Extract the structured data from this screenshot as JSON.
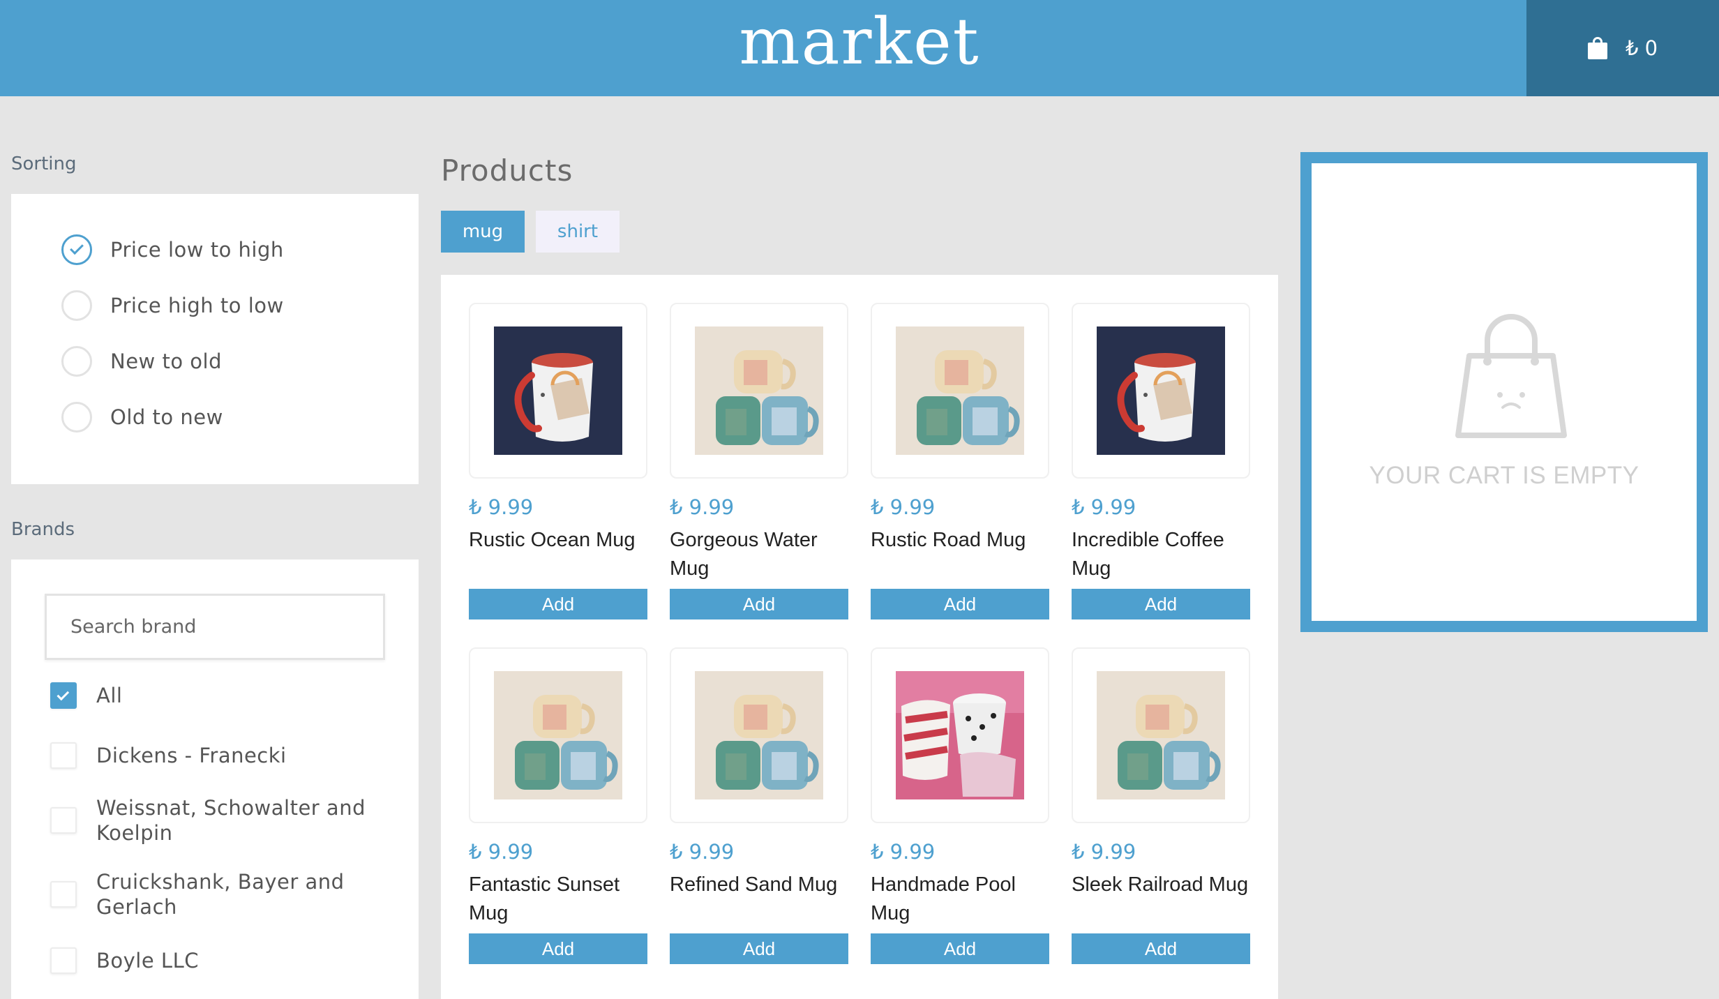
{
  "header": {
    "logo": "market",
    "cart_total": "₺ 0"
  },
  "sorting": {
    "label": "Sorting",
    "options": [
      {
        "label": "Price low to high",
        "selected": true
      },
      {
        "label": "Price high to low",
        "selected": false
      },
      {
        "label": "New to old",
        "selected": false
      },
      {
        "label": "Old to new",
        "selected": false
      }
    ]
  },
  "brands": {
    "label": "Brands",
    "search_placeholder": "Search brand",
    "items": [
      {
        "label": "All",
        "checked": true
      },
      {
        "label": "Dickens - Franecki",
        "checked": false
      },
      {
        "label": "Weissnat, Schowalter and Koelpin",
        "checked": false
      },
      {
        "label": "Cruickshank, Bayer and Gerlach",
        "checked": false
      },
      {
        "label": "Boyle LLC",
        "checked": false
      }
    ]
  },
  "products": {
    "title": "Products",
    "tags": [
      {
        "label": "mug",
        "active": true
      },
      {
        "label": "shirt",
        "active": false
      }
    ],
    "add_label": "Add",
    "items": [
      {
        "price": "₺ 9.99",
        "name": "Rustic Ocean Mug",
        "image": "red-mug-photo"
      },
      {
        "price": "₺ 9.99",
        "name": "Gorgeous Water Mug",
        "image": "ceramic-mugs-stack"
      },
      {
        "price": "₺ 9.99",
        "name": "Rustic Road Mug",
        "image": "ceramic-mugs-stack"
      },
      {
        "price": "₺ 9.99",
        "name": "Incredible Coffee Mug",
        "image": "red-mug-photo"
      },
      {
        "price": "₺ 9.99",
        "name": "Fantastic Sunset Mug",
        "image": "ceramic-mugs-stack"
      },
      {
        "price": "₺ 9.99",
        "name": "Refined Sand Mug",
        "image": "ceramic-mugs-stack"
      },
      {
        "price": "₺ 9.99",
        "name": "Handmade Pool Mug",
        "image": "pink-mugs"
      },
      {
        "price": "₺ 9.99",
        "name": "Sleek Railroad Mug",
        "image": "ceramic-mugs-stack"
      }
    ]
  },
  "cart": {
    "empty_text": "YOUR CART IS EMPTY",
    "icon": "sad-bag-icon"
  },
  "colors": {
    "primary": "#4ea0cf",
    "header_dark": "#2f6f93",
    "background": "#e5e5e5"
  }
}
